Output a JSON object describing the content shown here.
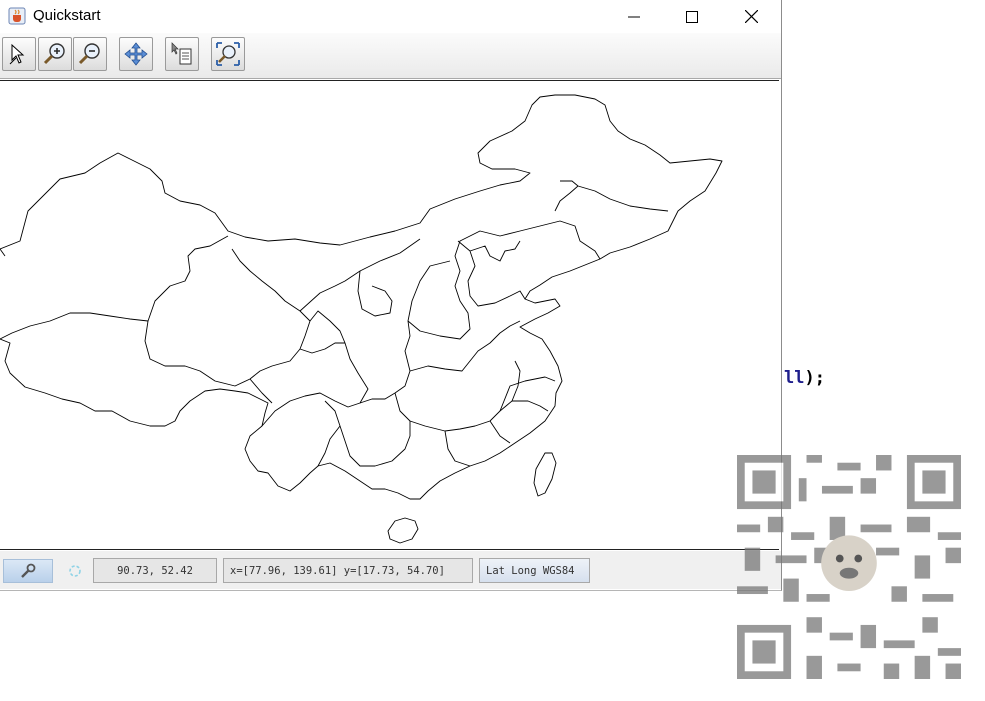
{
  "window": {
    "title": "Quickstart",
    "icons": {
      "app": "java-cup-icon",
      "minimize": "minimize-icon",
      "maximize": "maximize-icon",
      "close": "close-icon"
    }
  },
  "toolbar": {
    "tools": [
      {
        "name": "info-tool",
        "icon": "pointer-info-icon"
      },
      {
        "name": "zoom-in-tool",
        "icon": "zoom-in-icon"
      },
      {
        "name": "zoom-out-tool",
        "icon": "zoom-out-icon"
      },
      {
        "name": "pan-tool",
        "icon": "pan-arrows-icon"
      },
      {
        "name": "layer-info-tool",
        "icon": "pointer-layer-icon"
      },
      {
        "name": "reset-extent-tool",
        "icon": "full-extent-icon"
      }
    ]
  },
  "map": {
    "description_visible": false
  },
  "statusbar": {
    "settings_icon": "wrench-icon",
    "render_icon": "spinner-icon",
    "cursor_position": "90.73, 52.42",
    "extent": "x=[77.96, 139.61] y=[17.73, 54.70]",
    "crs": "Lat Long WGS84"
  },
  "code_fragment": {
    "text_keyword": "ll",
    "text_rest": ");"
  },
  "colors": {
    "map_outline": "#000000",
    "statusbar_bg": "#f0f0f0",
    "code_keyword": "#1e1e8c"
  }
}
